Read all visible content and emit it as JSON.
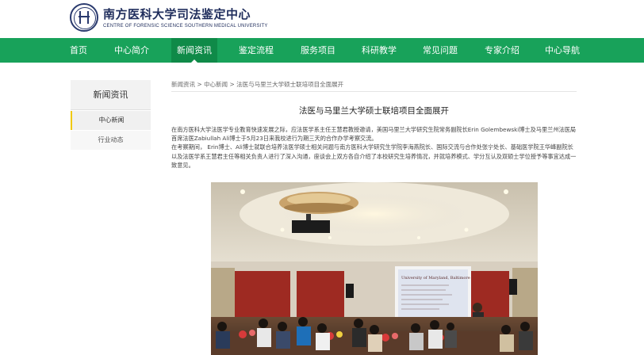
{
  "header": {
    "logo_cn": "南方医科大学司法鉴定中心",
    "logo_en": "CENTRE OF FORENSIC SCIENCE SOUTHERN MEDICAL UNIVERSITY"
  },
  "nav": {
    "items": [
      "首页",
      "中心简介",
      "新闻资讯",
      "鉴定流程",
      "服务项目",
      "科研教学",
      "常见问题",
      "专家介绍",
      "中心导航"
    ],
    "active": "新闻资讯"
  },
  "sidebar": {
    "title": "新闻资讯",
    "items": [
      "中心新闻",
      "行业动态"
    ],
    "active": "中心新闻"
  },
  "breadcrumb": {
    "items": [
      "新闻资讯",
      "中心新闻",
      "法医与马里兰大学硕士联培项目全面展开"
    ],
    "separator": " > "
  },
  "article": {
    "title": "法医与马里兰大学硕士联培项目全面展开",
    "paragraphs": [
      "在南方医科大学法医学专业教育快速发展之际，应法医学系主任王慧君教授邀请，美国马里兰大学研究生院常务副院长Erin Golembewski博士及马里兰州法医局首席法医Zabiullah  Ali博士于5月23日来我校进行为期三天的合作办学考察交流。",
      "在考察期间，  Erin博士、Ali博士就联合培养法医学硕士相关问题与南方医科大学研究生学院李海燕院长、国际交流与合作处张宁处长、基础医学院王华峰副院长以及法医学系王慧君主任等相关负责人进行了深入沟通，座谈会上双方各自介绍了本校研究生培养情况，并就培养模式、学分互认及双硕士学位授予等事宜达成一致意见。"
    ]
  },
  "photo": {
    "screen_title": "University of Maryland, Baltimore",
    "colors": {
      "ceiling": "#d9d2c4",
      "wall_red": "#9e2a22",
      "screen": "#dfe4ef",
      "chandelier": "#c9a36b"
    }
  },
  "colors": {
    "nav_bg": "#18a25a",
    "nav_active": "#0f8a48",
    "sidebar_accent": "#f0c800",
    "logo": "#1f2d5c"
  }
}
